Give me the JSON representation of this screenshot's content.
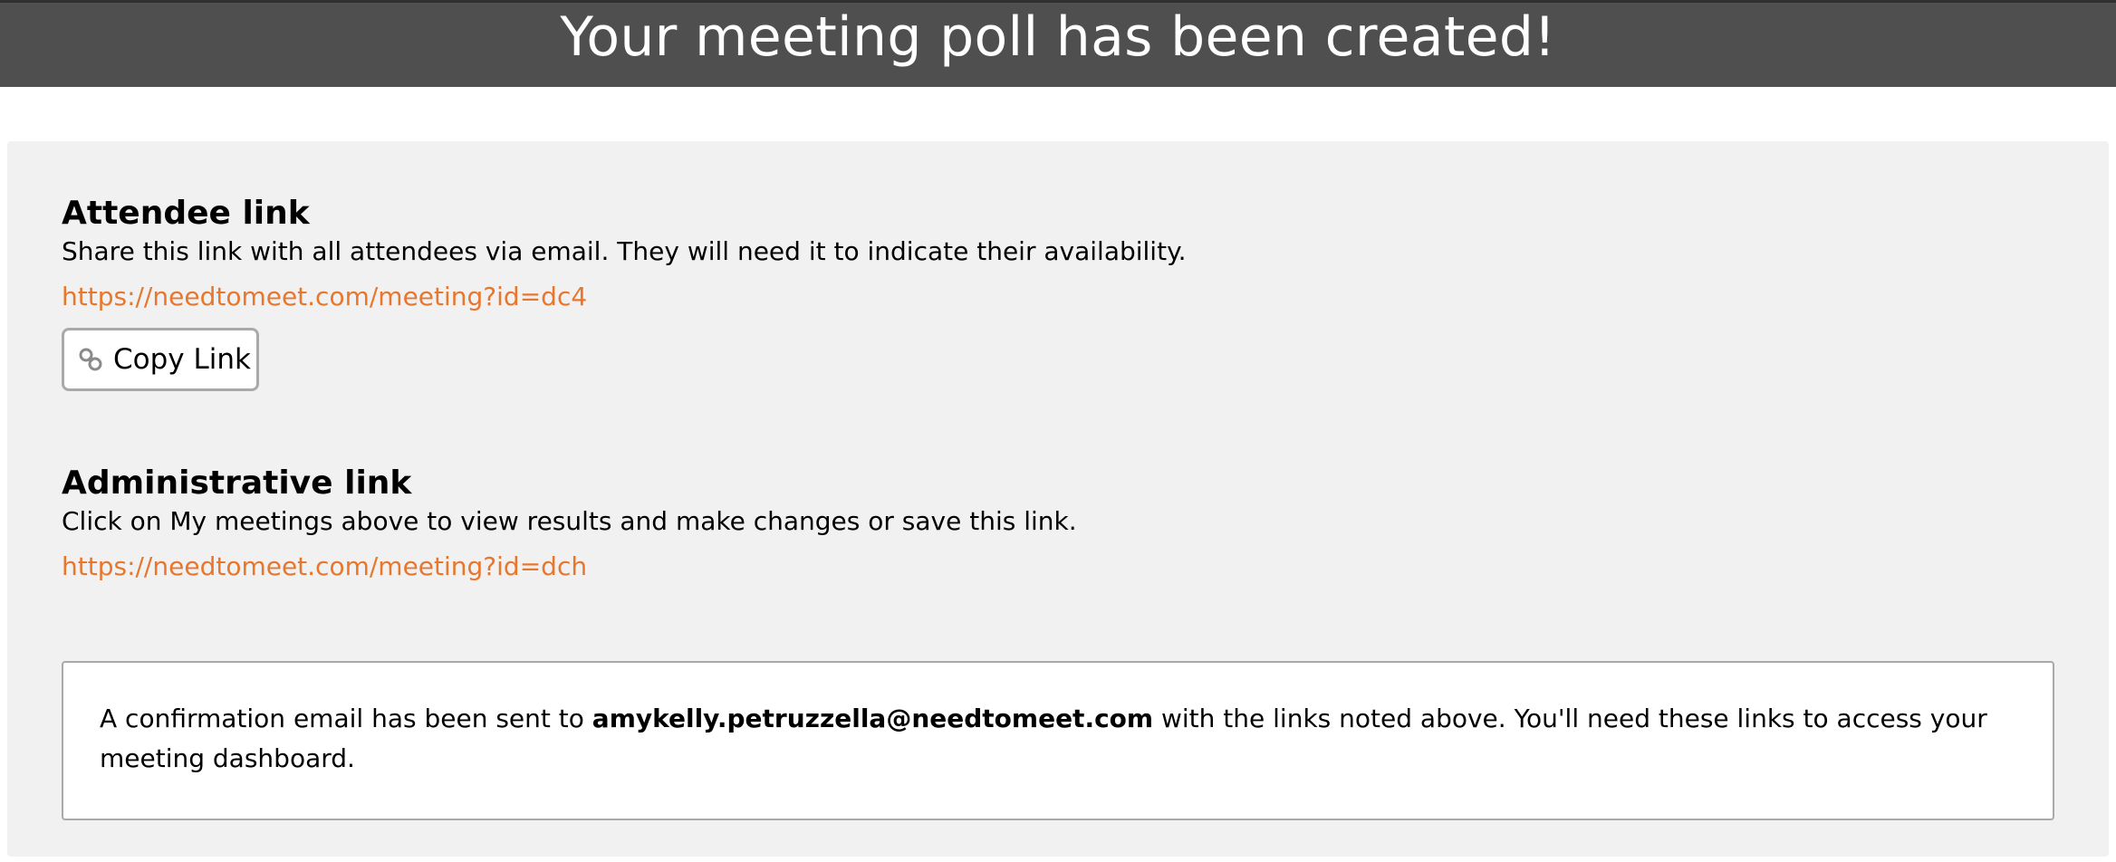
{
  "header": {
    "title": "Your meeting poll has been created!",
    "background_color": "#4f4f4f"
  },
  "attendee": {
    "title": "Attendee link",
    "description": "Share this link with all attendees via email. They will need it to indicate their availability.",
    "link": "https://needtomeet.com/meeting?id=dc4",
    "copy_button_label": "Copy Link",
    "copy_button_icon": "link-icon"
  },
  "admin": {
    "title": "Administrative link",
    "description": "Click on My meetings above to view results and make changes or save this link.",
    "link": "https://needtomeet.com/meeting?id=dch"
  },
  "notice": {
    "text_before": "A confirmation email has been sent to ",
    "email": "amykelly.petruzzella@needtomeet.com",
    "text_after": " with the links noted above. You'll need these links to access your meeting dashboard."
  },
  "colors": {
    "link": "#e8772e",
    "panel_background": "#f1f1f1"
  }
}
